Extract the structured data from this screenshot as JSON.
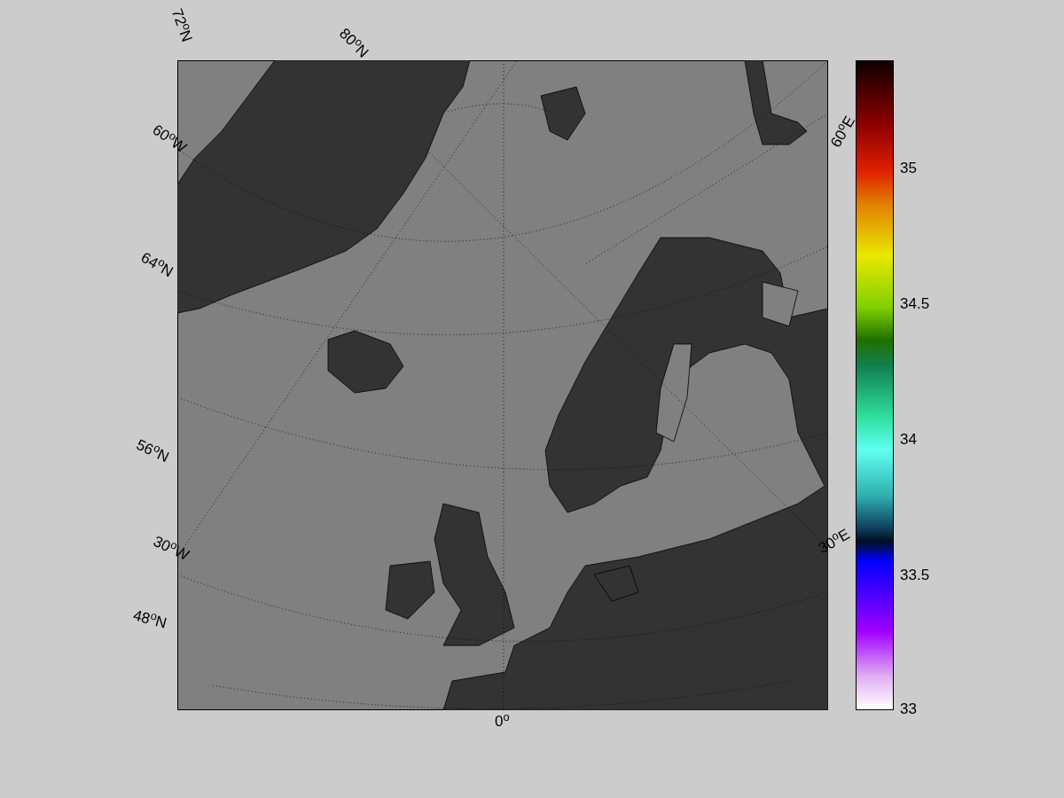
{
  "map": {
    "grid_labels": [
      "72$^{o}$N",
      "80$^{o}$N",
      "60$^{o}$W",
      "64$^{o}$N",
      "60$^{o}$E",
      "56$^{o}$N",
      "30$^{o}$W",
      "30$^{o}$E",
      "48$^{o}$N",
      "0$^{o}$"
    ]
  },
  "colorbar": {
    "ticks": [
      "35",
      "34.5",
      "34",
      "33.5",
      "33"
    ]
  }
}
